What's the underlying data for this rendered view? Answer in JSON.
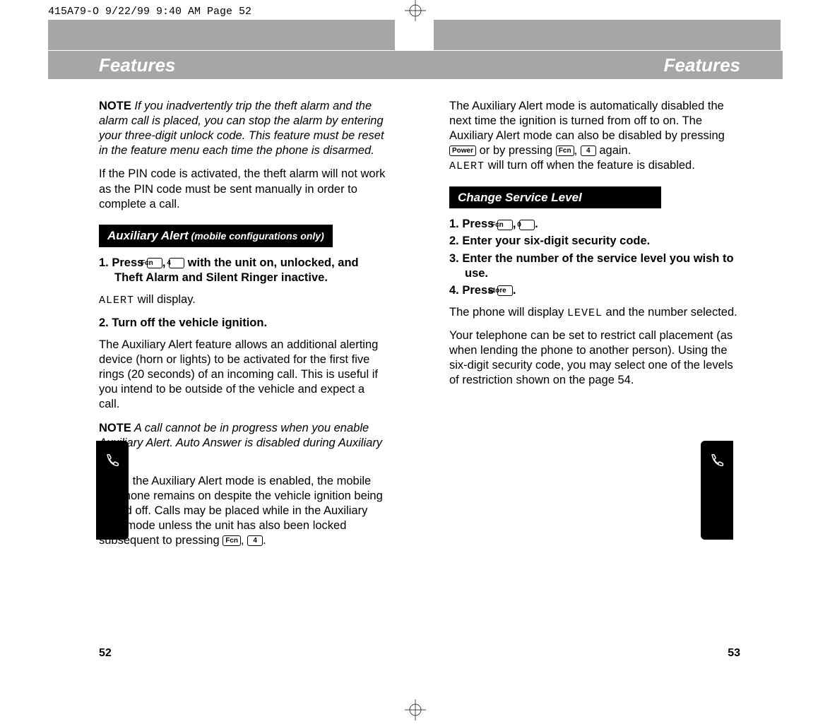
{
  "slug": "415A79-O  9/22/99 9:40 AM  Page 52",
  "header": {
    "title": "Features"
  },
  "keys": {
    "fcn": "Fcn",
    "four": "4",
    "power": "Power",
    "zero": "0",
    "store": "Store"
  },
  "lcd": {
    "alert": "ALERT",
    "level": "LEVEL"
  },
  "left": {
    "note1_lead": "NOTE",
    "note1_body": " If you inadvertently trip the theft alarm and the alarm call is placed, you can stop the alarm by entering your three-digit unlock code. This feature must be reset in the feature menu each time the phone is disarmed.",
    "p_pin": "If the PIN code is activated, the theft alarm will not work as the PIN code must be sent manually in order to complete a call.",
    "section1_title": "Auxiliary Alert",
    "section1_sub": " (mobile configurations only)",
    "step1_a": "1.  Press ",
    "step1_b": " with the unit on, unlocked, and Theft Alarm and Silent Ringer inactive.",
    "p_alert_display": " will display.",
    "step2": "2.  Turn off the vehicle ignition.",
    "p_feature_desc": "The Auxiliary Alert feature allows an additional alerting device (horn or lights) to be activated for the first five rings (20 seconds) of an incoming call. This is useful if you intend to be outside of the vehicle and expect a call.",
    "note2_lead": "NOTE",
    "note2_body": " A call cannot be in progress when you enable Auxiliary Alert. Auto Answer is disabled during Auxiliary Alert.",
    "p_enabled_a": "When the Auxiliary Alert mode is enabled, the mobile telephone remains on despite the vehicle ignition being turned off. Calls may be placed while in the Auxiliary Alert mode unless the unit has also been locked subsequent to pressing ",
    "p_enabled_b": ".",
    "pagenum": "52"
  },
  "right": {
    "p_disabled_a": "The Auxiliary Alert mode is automatically disabled the next time the ignition is turned from off to on. The Auxiliary Alert mode can also be disabled by pressing ",
    "p_disabled_b": " or by pressing ",
    "p_disabled_c": " again.",
    "p_alert_off": " will turn off when the feature is disabled.",
    "section2_title": "Change Service Level",
    "step1_a": "1.  Press ",
    "step1_b": ".",
    "step2": "2.  Enter your six-digit security code.",
    "step3": "3.  Enter the number of the service level you wish to use.",
    "step4_a": "4.  Press ",
    "step4_b": ".",
    "p_level_a": "The phone will display ",
    "p_level_b": " and the number selected.",
    "p_restrict": "Your telephone can be set to restrict call placement (as when lending the phone to another person). Using the six-digit security code, you may select one of the levels of restriction shown on the page 54.",
    "pagenum": "53"
  }
}
